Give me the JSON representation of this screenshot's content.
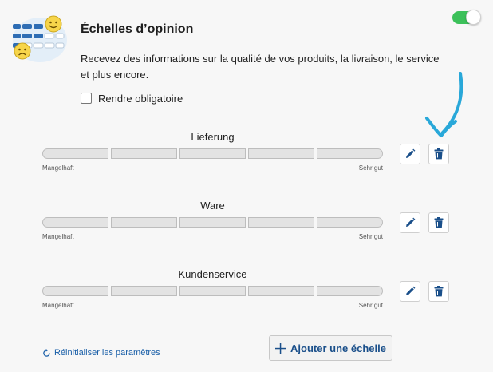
{
  "header": {
    "title": "Échelles d’opinion",
    "description": "Recevez des informations sur la qualité de vos produits, la livraison, le service et plus encore.",
    "illustration_icon": "opinion-scales-illustration",
    "toggle_enabled": true,
    "toggle_color": "#3cc15a"
  },
  "required_checkbox": {
    "label": "Rendre obligatoire",
    "checked": false
  },
  "scales": [
    {
      "label": "Lieferung",
      "low_label": "Mangelhaft",
      "high_label": "Sehr gut",
      "segments": 5
    },
    {
      "label": "Ware",
      "low_label": "Mangelhaft",
      "high_label": "Sehr gut",
      "segments": 5
    },
    {
      "label": "Kundenservice",
      "low_label": "Mangelhaft",
      "high_label": "Sehr gut",
      "segments": 5
    }
  ],
  "actions": {
    "edit_icon": "pencil-icon",
    "delete_icon": "trash-icon",
    "icon_color": "#1a4f8a"
  },
  "footer": {
    "reset_label": "Réinitialiser les paramètres",
    "add_label": "Ajouter une échelle"
  },
  "annotation": {
    "arrow_color": "#29a8d9"
  }
}
